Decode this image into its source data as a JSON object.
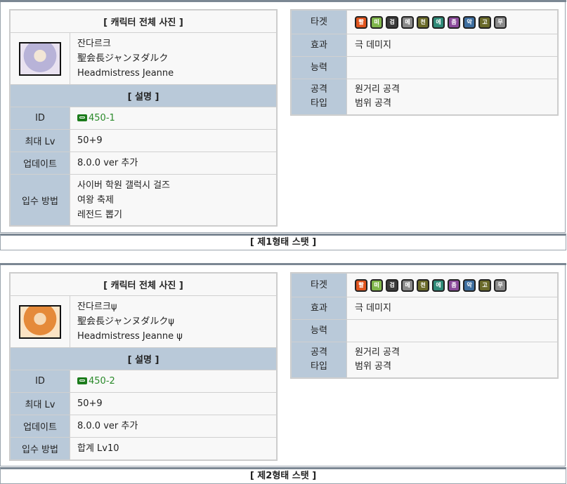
{
  "forms": [
    {
      "photo_header": "[ 캐릭터 전체 사진 ]",
      "names": [
        "잔다르크",
        "聖会長ジャンヌダルク",
        "Headmistress Jeanne"
      ],
      "portrait_color": "#b8b3d8",
      "desc_header": "[ 설명 ]",
      "id_label": "ID",
      "id_value": "450-1",
      "lv_label": "최대 Lv",
      "lv_value": "50+9",
      "update_label": "업데이트",
      "update_value": "8.0.0 ver 추가",
      "obtain_label": "입수 방법",
      "obtain_values": [
        "사이버 학원 갤럭시 걸즈",
        "여왕 축제",
        "레전드 뽑기"
      ],
      "target_label": "타겟",
      "targets": [
        {
          "icon": "red-target-icon",
          "text": "빨",
          "color": "#e0551f"
        },
        {
          "icon": "floating-target-icon",
          "text": "떠",
          "color": "#7fb64b"
        },
        {
          "icon": "black-target-icon",
          "text": "검",
          "color": "#3a3a3a"
        },
        {
          "icon": "metal-target-icon",
          "text": "메",
          "color": "#8a8a8a"
        },
        {
          "icon": "angel-target-icon",
          "text": "천",
          "color": "#6b6b2a"
        },
        {
          "icon": "alien-target-icon",
          "text": "에",
          "color": "#2f8a78"
        },
        {
          "icon": "zombie-target-icon",
          "text": "좀",
          "color": "#8a4a9a"
        },
        {
          "icon": "relic-target-icon",
          "text": "악",
          "color": "#3f6fa0"
        },
        {
          "icon": "aku-target-icon",
          "text": "고",
          "color": "#6a6a2a"
        },
        {
          "icon": "white-target-icon",
          "text": "무",
          "color": "#8a8a8a"
        }
      ],
      "effect_label": "효과",
      "effect_value": "극 데미지",
      "ability_label": "능력",
      "ability_value": "",
      "attack_label": [
        "공격",
        "타입"
      ],
      "attack_values": [
        "원거리 공격",
        "범위 공격"
      ]
    },
    {
      "photo_header": "[ 캐릭터 전체 사진 ]",
      "names": [
        "잔다르크ψ",
        "聖会長ジャンヌダルクψ",
        "Headmistress Jeanne ψ"
      ],
      "portrait_color": "#e58a3a",
      "desc_header": "[ 설명 ]",
      "id_label": "ID",
      "id_value": "450-2",
      "lv_label": "최대 Lv",
      "lv_value": "50+9",
      "update_label": "업데이트",
      "update_value": "8.0.0 ver 추가",
      "obtain_label": "입수 방법",
      "obtain_values": [
        "합계 Lv10"
      ],
      "target_label": "타겟",
      "targets": [
        {
          "icon": "red-target-icon",
          "text": "빨",
          "color": "#e0551f"
        },
        {
          "icon": "floating-target-icon",
          "text": "떠",
          "color": "#7fb64b"
        },
        {
          "icon": "black-target-icon",
          "text": "검",
          "color": "#3a3a3a"
        },
        {
          "icon": "metal-target-icon",
          "text": "메",
          "color": "#8a8a8a"
        },
        {
          "icon": "angel-target-icon",
          "text": "천",
          "color": "#6b6b2a"
        },
        {
          "icon": "alien-target-icon",
          "text": "에",
          "color": "#2f8a78"
        },
        {
          "icon": "zombie-target-icon",
          "text": "좀",
          "color": "#8a4a9a"
        },
        {
          "icon": "relic-target-icon",
          "text": "악",
          "color": "#3f6fa0"
        },
        {
          "icon": "aku-target-icon",
          "text": "고",
          "color": "#6a6a2a"
        },
        {
          "icon": "white-target-icon",
          "text": "무",
          "color": "#8a8a8a"
        }
      ],
      "effect_label": "효과",
      "effect_value": "극 데미지",
      "ability_label": "능력",
      "ability_value": "",
      "attack_label": [
        "공격",
        "타입"
      ],
      "attack_values": [
        "원거리 공격",
        "범위 공격"
      ]
    }
  ],
  "banners": [
    "[ 제1형태 스탯 ]",
    "[ 제2형태 스탯 ]"
  ]
}
